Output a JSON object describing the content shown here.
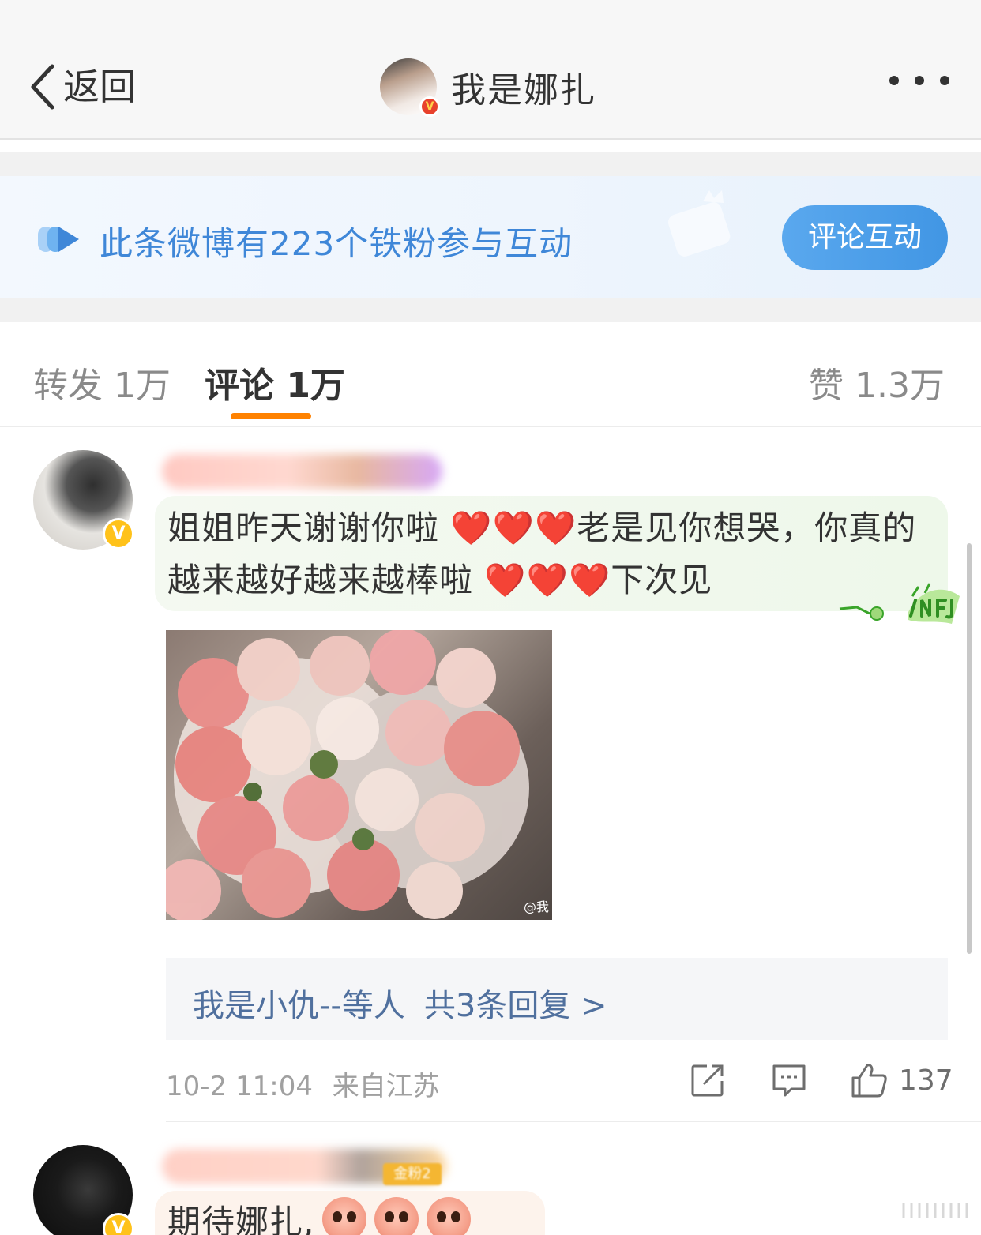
{
  "nav": {
    "back_label": "返回",
    "profile_name": "我是娜扎",
    "verified_mark": "V"
  },
  "banner": {
    "text": "此条微博有223个铁粉参与互动",
    "button_label": "评论互动"
  },
  "tabs": {
    "repost": "转发 1万",
    "comment": "评论 1万",
    "like": "赞 1.3万"
  },
  "comments": [
    {
      "verified_mark": "V",
      "text_part1": "姐姐昨天谢谢你啦 ",
      "hearts1": "❤️❤️❤️",
      "text_part2": "老是见你想哭，你真的越来越好越来越棒啦 ",
      "hearts2": "❤️❤️❤️",
      "text_part3": "下次见",
      "image_watermark": "@我",
      "replies_names": "我是小仇--等人",
      "replies_count": "共3条回复 >",
      "timestamp": "10-2 11:04",
      "location": "来自江苏",
      "like_count": "137"
    },
    {
      "verified_mark": "V",
      "badge": "金粉2",
      "text": "期待娜扎,"
    }
  ],
  "colors": {
    "accent_orange": "#ff8200",
    "link_blue": "#50709e",
    "banner_blue": "#3f87d8",
    "button_blue": "#4196e4"
  },
  "icons": [
    "chevron-left-icon",
    "more-dots-icon",
    "fan-interaction-icon",
    "share-icon",
    "comment-icon",
    "like-icon"
  ]
}
